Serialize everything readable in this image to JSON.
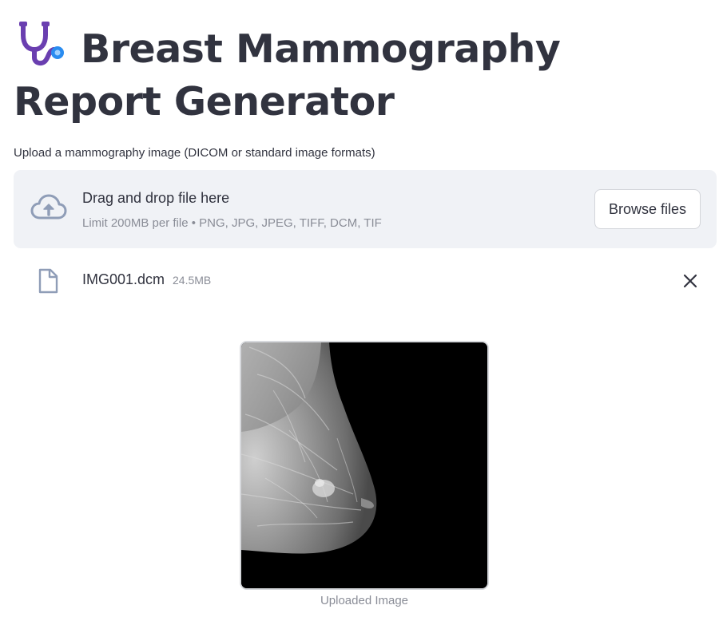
{
  "page": {
    "title_emoji": "stethoscope-icon",
    "title": "Breast Mammography Report Generator"
  },
  "uploader": {
    "label": "Upload a mammography image (DICOM or standard image formats)",
    "dropzone_text": "Drag and drop file here",
    "limit_text": "Limit 200MB per file • PNG, JPG, JPEG, TIFF, DCM, TIF",
    "browse_label": "Browse files",
    "upload_icon": "cloud-upload-icon"
  },
  "uploaded_file": {
    "name": "IMG001.dcm",
    "size": "24.5MB",
    "icon": "file-icon",
    "remove_icon": "close-icon"
  },
  "preview": {
    "caption": "Uploaded Image"
  },
  "colors": {
    "text": "#31333f",
    "muted": "#8a8d97",
    "dropzone_bg": "#f0f2f6",
    "border": "#d3d5da",
    "stethoscope_tube": "#6a3fb0",
    "stethoscope_chest": "#2a8cf0"
  }
}
